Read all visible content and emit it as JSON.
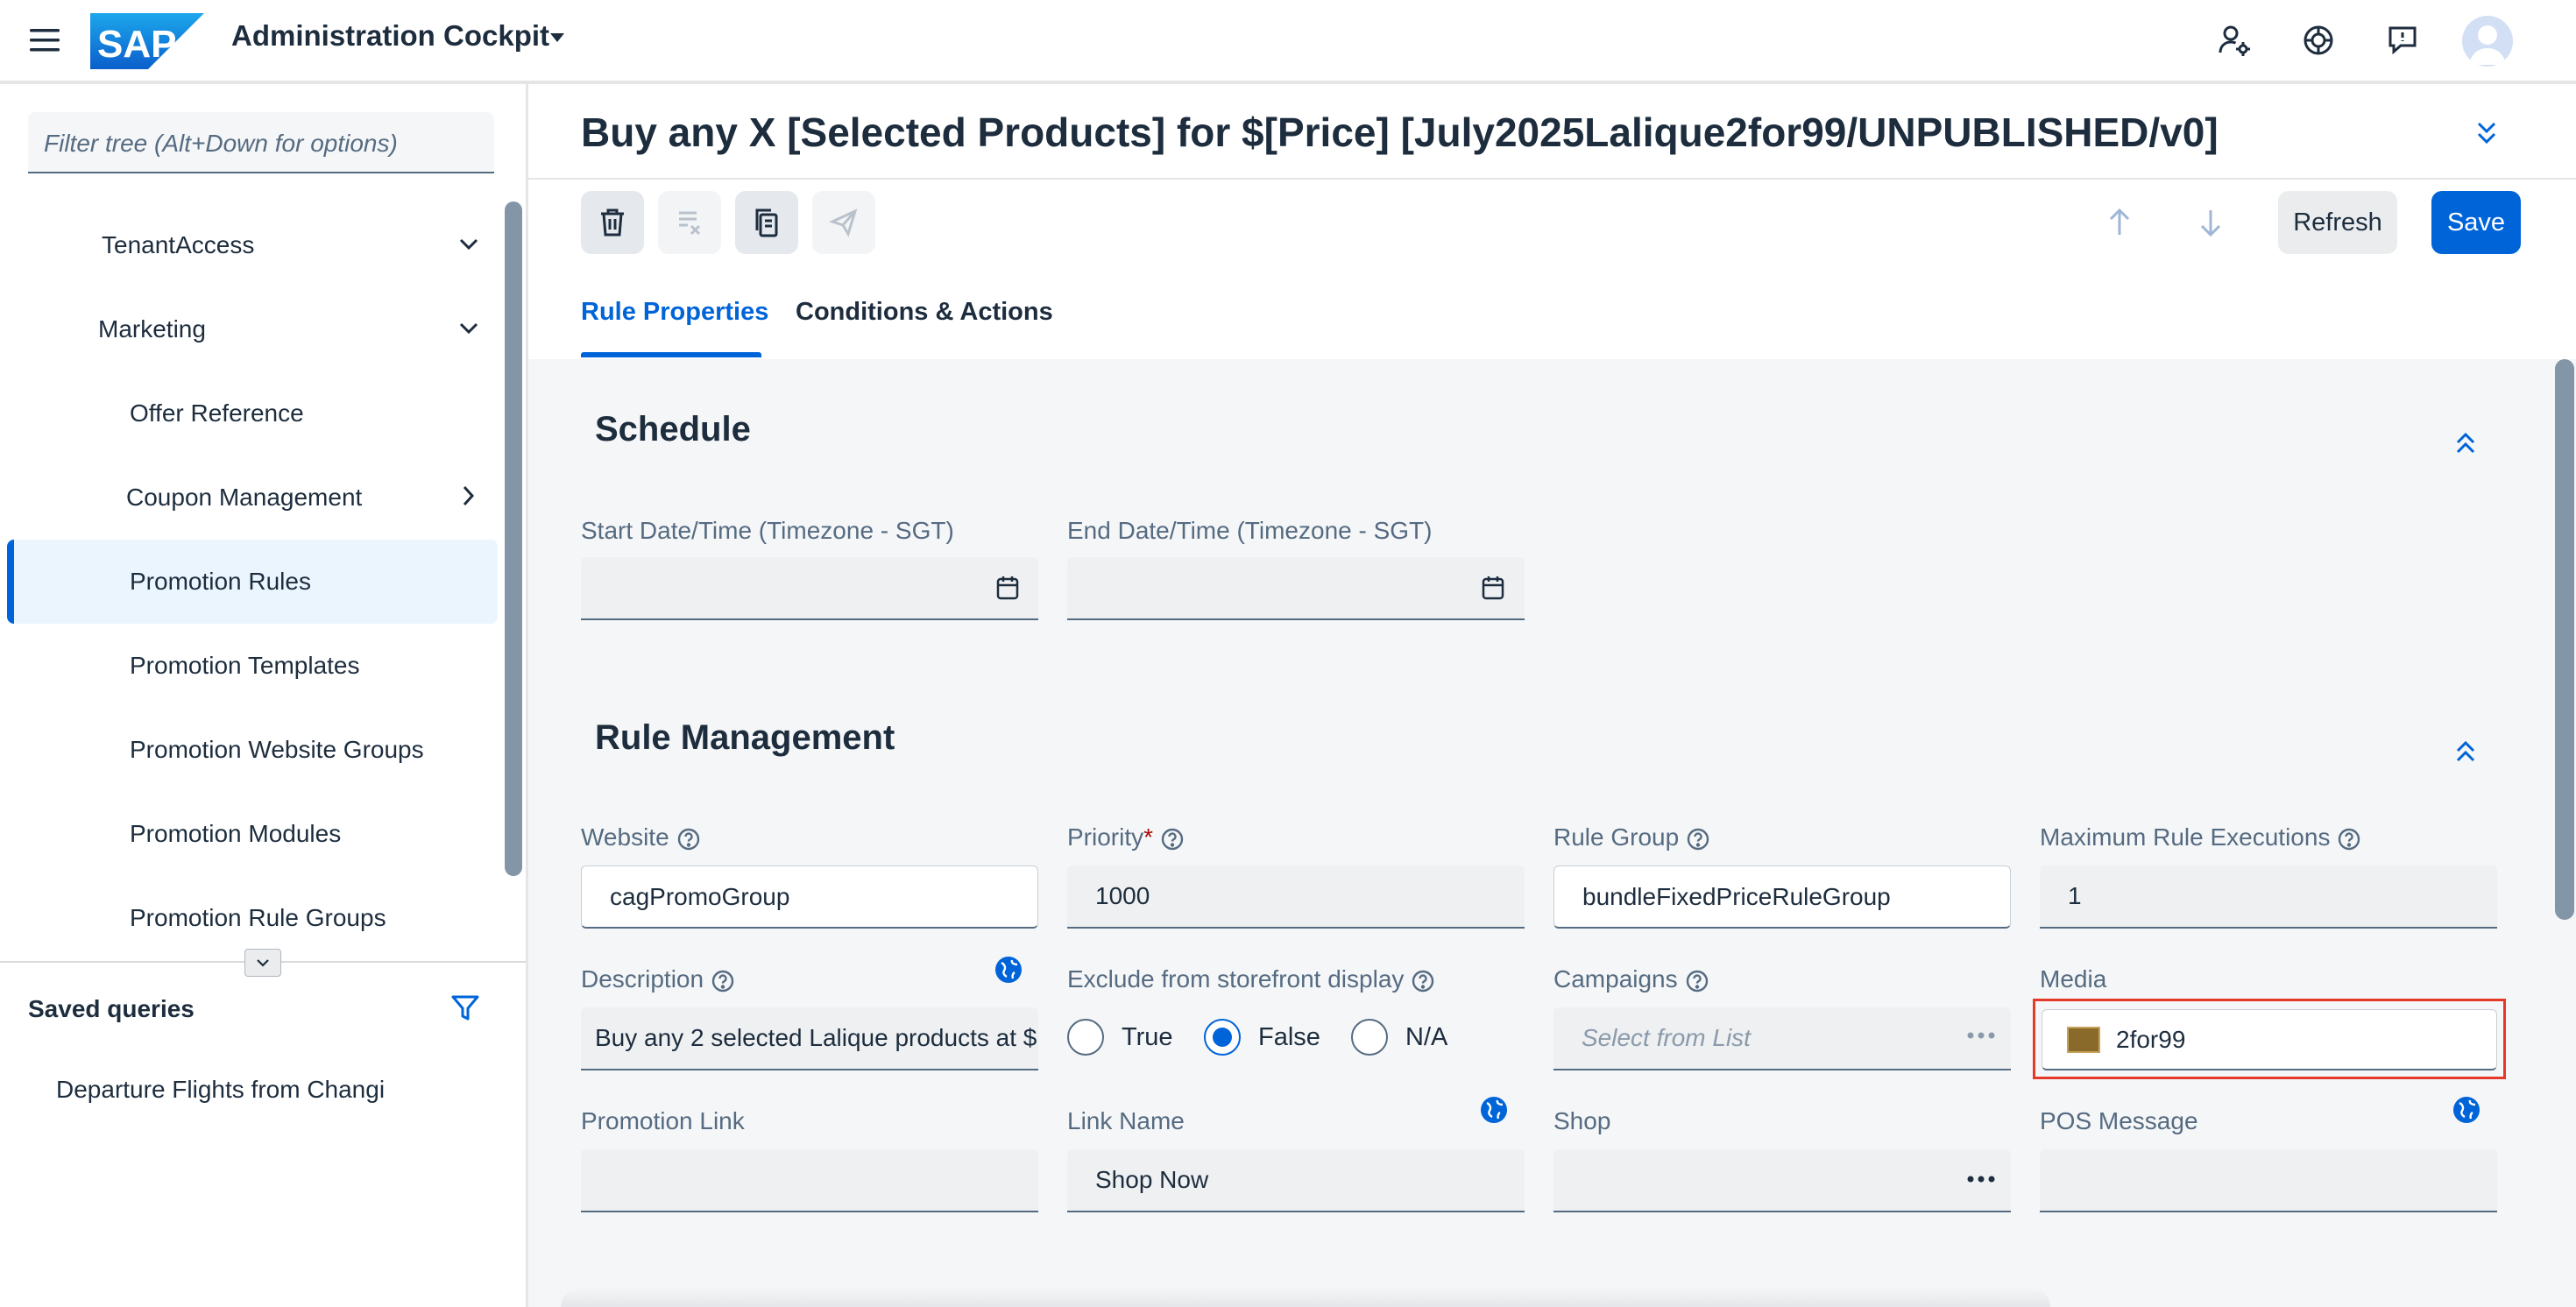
{
  "shell": {
    "logo_text": "SAP",
    "title": "Administration Cockpit"
  },
  "left_panel": {
    "filter_placeholder": "Filter tree (Alt+Down for options)",
    "tree": [
      {
        "label": "TenantAccess",
        "expander": "chevron-down"
      },
      {
        "label": "Marketing",
        "expander": "chevron-down"
      },
      {
        "label": "Offer Reference"
      },
      {
        "label": "Coupon Management",
        "expander": "chevron-right"
      },
      {
        "label": "Promotion Rules",
        "selected": true
      },
      {
        "label": "Promotion Templates"
      },
      {
        "label": "Promotion Website Groups"
      },
      {
        "label": "Promotion Modules"
      },
      {
        "label": "Promotion Rule Groups"
      }
    ],
    "saved_queries_title": "Saved queries",
    "saved_queries": [
      "Departure Flights from Changi"
    ]
  },
  "header": {
    "title": "Buy any X [Selected Products] for $[Price] [July2025Lalique2for99/UNPUBLISHED/v0]",
    "refresh_label": "Refresh",
    "save_label": "Save"
  },
  "tabs": [
    {
      "label": "Rule Properties",
      "active": true
    },
    {
      "label": "Conditions & Actions",
      "active": false
    }
  ],
  "schedule": {
    "title": "Schedule",
    "start_label": "Start Date/Time (Timezone - SGT)",
    "start_value": "",
    "end_label": "End Date/Time (Timezone - SGT)",
    "end_value": ""
  },
  "rule_management": {
    "title": "Rule Management",
    "website": {
      "label": "Website",
      "value": "cagPromoGroup"
    },
    "priority": {
      "label": "Priority",
      "required_mark": "*",
      "value": "1000"
    },
    "rule_group": {
      "label": "Rule Group",
      "value": "bundleFixedPriceRuleGroup"
    },
    "max_exec": {
      "label": "Maximum Rule Executions",
      "value": "1"
    },
    "description": {
      "label": "Description",
      "value": "Buy any 2 selected Lalique products at $"
    },
    "exclude": {
      "label": "Exclude from storefront display",
      "options": [
        "True",
        "False",
        "N/A"
      ],
      "selected": "False"
    },
    "campaigns": {
      "label": "Campaigns",
      "placeholder": "Select from List"
    },
    "media": {
      "label": "Media",
      "value": "2for99"
    },
    "promotion_link": {
      "label": "Promotion Link",
      "value": ""
    },
    "link_name": {
      "label": "Link Name",
      "value": "Shop Now"
    },
    "shop": {
      "label": "Shop",
      "value": ""
    },
    "pos_message": {
      "label": "POS Message",
      "value": ""
    }
  },
  "colors": {
    "accent": "#0064d9",
    "highlight_border": "#e53a2a",
    "required": "#aa0808"
  }
}
